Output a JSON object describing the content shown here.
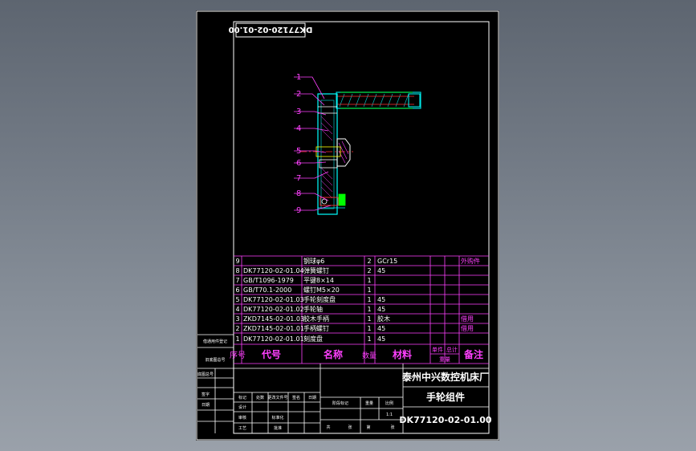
{
  "drawing_number_stamp": "DK77120-02-01.00",
  "balloons": [
    "1",
    "2",
    "3",
    "4",
    "5",
    "6",
    "7",
    "8",
    "9"
  ],
  "bom": [
    {
      "no": "9",
      "code": "",
      "name": "钢球φ6",
      "qty": "2",
      "material": "GCr15",
      "remark": "外购件"
    },
    {
      "no": "8",
      "code": "DK77120-02-01.04",
      "name": "弹簧螺钉",
      "qty": "2",
      "material": "45",
      "remark": ""
    },
    {
      "no": "7",
      "code": "GB/T1096-1979",
      "name": "平键8×14",
      "qty": "1",
      "material": "",
      "remark": ""
    },
    {
      "no": "6",
      "code": "GB/T70.1-2000",
      "name": "螺钉M5×20",
      "qty": "1",
      "material": "",
      "remark": ""
    },
    {
      "no": "5",
      "code": "DK77120-02-01.03",
      "name": "手轮刻度盘",
      "qty": "1",
      "material": "45",
      "remark": ""
    },
    {
      "no": "4",
      "code": "DK77120-02-01.02",
      "name": "手轮轴",
      "qty": "1",
      "material": "45",
      "remark": ""
    },
    {
      "no": "3",
      "code": "ZKD7145-02-01.03",
      "name": "胶木手柄",
      "qty": "1",
      "material": "胶木",
      "remark": "借用"
    },
    {
      "no": "2",
      "code": "ZKD7145-02-01.01",
      "name": "手柄螺钉",
      "qty": "1",
      "material": "45",
      "remark": "借用"
    },
    {
      "no": "1",
      "code": "DK77120-02-01.01",
      "name": "刻度盘",
      "qty": "1",
      "material": "45",
      "remark": ""
    }
  ],
  "bom_header": {
    "no": "序号",
    "code": "代号",
    "name": "名称",
    "qty": "数量",
    "material": "材料",
    "unit_weight": "单件",
    "total_weight": "总计",
    "weight": "重量",
    "remark": "备注"
  },
  "company": "泰州中兴数控机床厂",
  "part_name": "手轮组件",
  "drawing_number": "DK77120-02-01.00",
  "side_labels": [
    "借通用件登记",
    "旧底图总号",
    "底图总号",
    "签字",
    "日期"
  ],
  "title_small": [
    "标记",
    "处数",
    "更改文件号",
    "签名",
    "日期",
    "设计",
    "审核",
    "工艺",
    "标准化",
    "批准",
    "阶段标记",
    "重量",
    "比例",
    "共",
    "张",
    "第",
    "张"
  ],
  "scale": "1:1"
}
